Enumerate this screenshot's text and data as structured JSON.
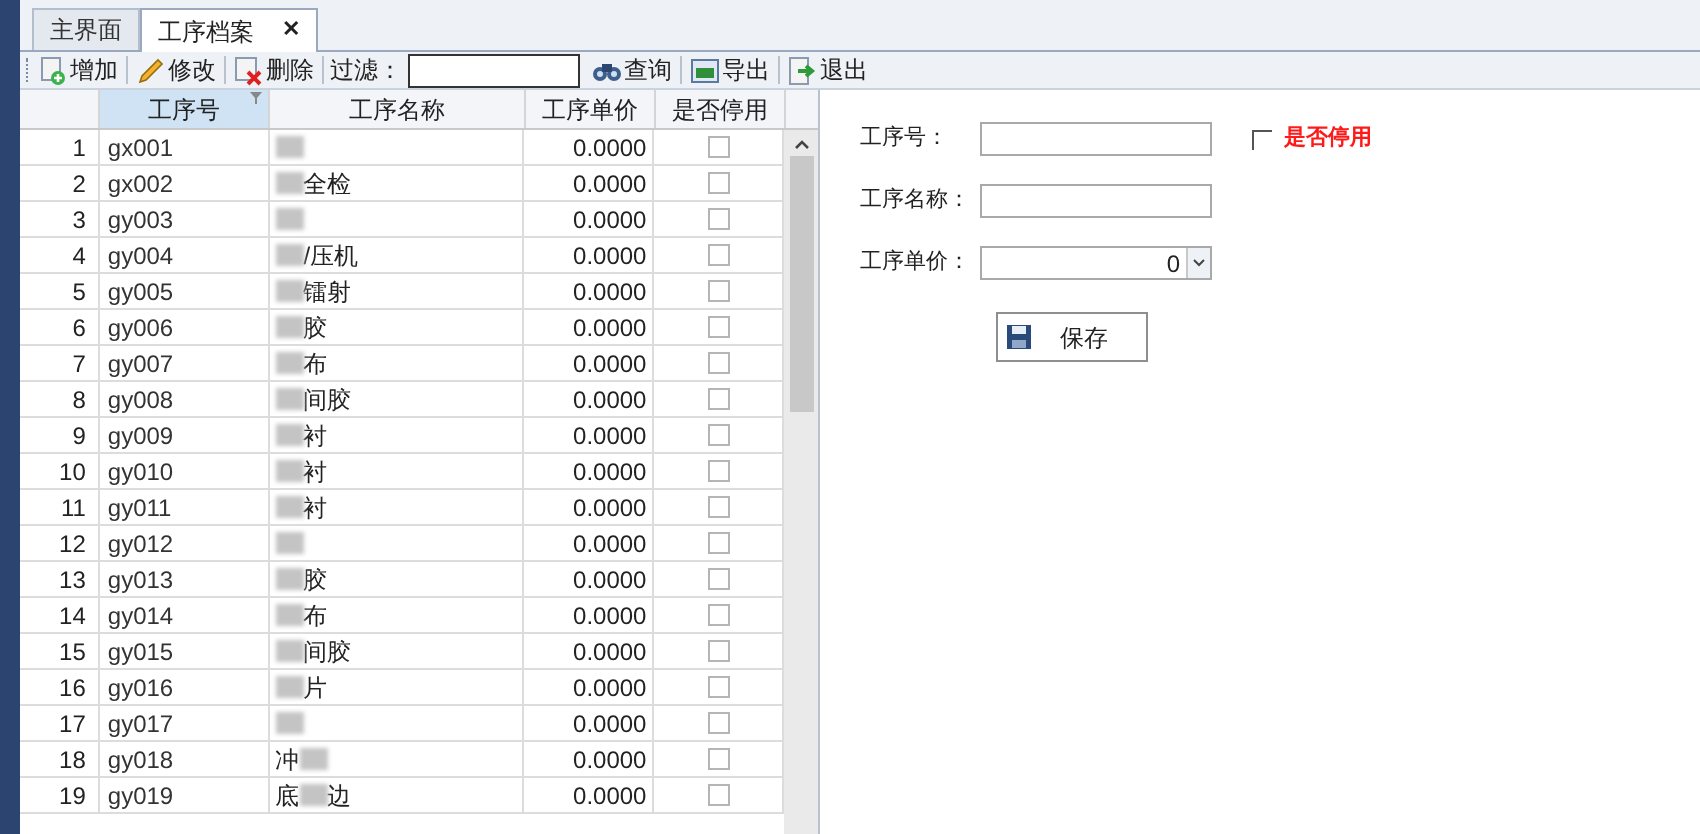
{
  "tabs": [
    {
      "label": "主界面",
      "selected": false
    },
    {
      "label": "工序档案",
      "selected": true,
      "close": "✕"
    }
  ],
  "toolbar": {
    "buttons": [
      {
        "label": "增加"
      },
      {
        "label": "修改"
      },
      {
        "label": "删除"
      }
    ],
    "filter_label": "过滤：",
    "actions": [
      {
        "label": "查询"
      },
      {
        "label": "导出"
      },
      {
        "label": "退出"
      }
    ]
  },
  "table": {
    "columns": [
      "工序号",
      "工序名称",
      "工序单价",
      "是否停用"
    ],
    "rows": [
      {
        "n": "1",
        "code": "gx001",
        "price": "0.0000",
        "checked": false
      },
      {
        "n": "2",
        "code": "gx002",
        "name_suffix": "全检",
        "price": "0.0000",
        "checked": false
      },
      {
        "n": "3",
        "code": "gy003",
        "price": "0.0000",
        "checked": false
      },
      {
        "n": "4",
        "code": "gy004",
        "name_suffix": "/压机",
        "price": "0.0000",
        "checked": false
      },
      {
        "n": "5",
        "code": "gy005",
        "name_suffix": "镭射",
        "price": "0.0000",
        "checked": false
      },
      {
        "n": "6",
        "code": "gy006",
        "name_suffix": "胶",
        "price": "0.0000",
        "checked": false
      },
      {
        "n": "7",
        "code": "gy007",
        "name_suffix": "布",
        "price": "0.0000",
        "checked": false
      },
      {
        "n": "8",
        "code": "gy008",
        "name_suffix": "间胶",
        "price": "0.0000",
        "checked": false
      },
      {
        "n": "9",
        "code": "gy009",
        "name_suffix": "衬",
        "price": "0.0000",
        "checked": false
      },
      {
        "n": "10",
        "code": "gy010",
        "name_suffix": "衬",
        "price": "0.0000",
        "checked": false
      },
      {
        "n": "11",
        "code": "gy011",
        "name_suffix": "衬",
        "price": "0.0000",
        "checked": false
      },
      {
        "n": "12",
        "code": "gy012",
        "price": "0.0000",
        "checked": false
      },
      {
        "n": "13",
        "code": "gy013",
        "name_suffix": "胶",
        "price": "0.0000",
        "checked": false
      },
      {
        "n": "14",
        "code": "gy014",
        "name_suffix": "布",
        "price": "0.0000",
        "checked": false
      },
      {
        "n": "15",
        "code": "gy015",
        "name_suffix": "间胶",
        "price": "0.0000",
        "checked": false
      },
      {
        "n": "16",
        "code": "gy016",
        "name_suffix": "片",
        "price": "0.0000",
        "checked": false
      },
      {
        "n": "17",
        "code": "gy017",
        "price": "0.0000",
        "checked": false
      },
      {
        "n": "18",
        "code": "gy018",
        "name_prefix": "冲",
        "price": "0.0000",
        "checked": false
      },
      {
        "n": "19",
        "code": "gy019",
        "name_prefix": "底",
        "name_suffix": "边",
        "price": "0.0000",
        "checked": false
      }
    ]
  },
  "form": {
    "fields": [
      {
        "label": "工序号：",
        "kind": "text"
      },
      {
        "label": "工序名称：",
        "kind": "text"
      },
      {
        "label": "工序单价：",
        "kind": "spin",
        "value": "0"
      }
    ],
    "disabled_checkbox": {
      "label": "是否停用",
      "checked": false
    },
    "save_button": "保存"
  }
}
